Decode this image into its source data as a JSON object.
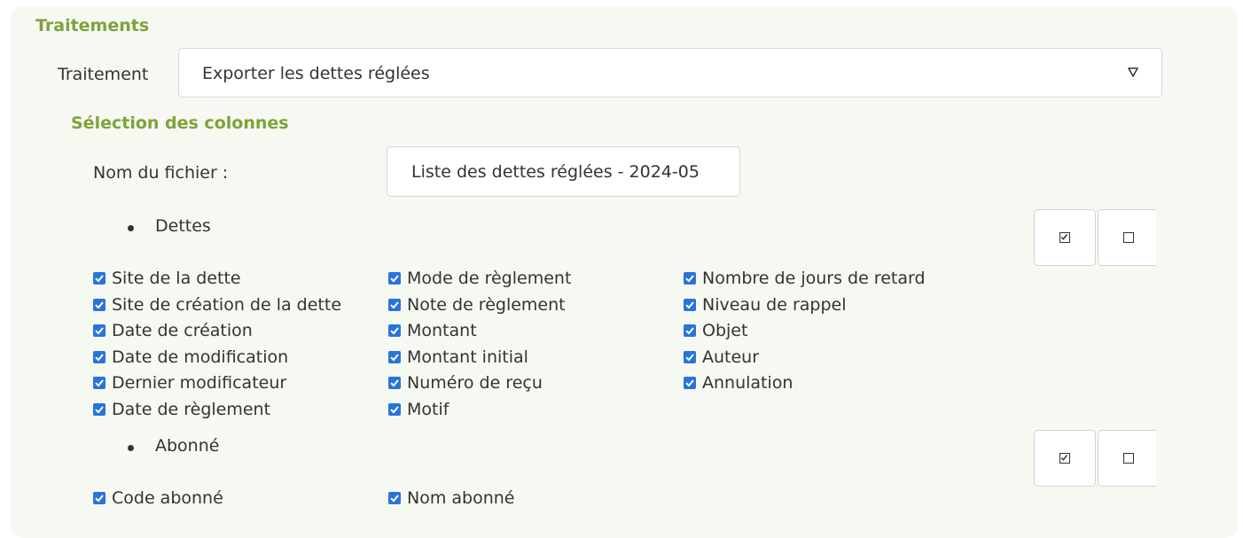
{
  "section": {
    "title": "Traitements"
  },
  "treatment": {
    "label": "Traitement",
    "selected": "Exporter les dettes réglées"
  },
  "columns": {
    "title": "Sélection des colonnes",
    "filename_label": "Nom du fichier :",
    "filename_value": "Liste des dettes réglées - 2024-05"
  },
  "groups": [
    {
      "name": "Dettes",
      "columns": [
        [
          "Site de la dette",
          "Site de création de la dette",
          "Date de création",
          "Date de modification",
          "Dernier modificateur",
          "Date de règlement"
        ],
        [
          "Mode de règlement",
          "Note de règlement",
          "Montant",
          "Montant initial",
          "Numéro de reçu",
          "Motif"
        ],
        [
          "Nombre de jours de retard",
          "Niveau de rappel",
          "Objet",
          "Auteur",
          "Annulation"
        ]
      ]
    },
    {
      "name": "Abonné",
      "columns": [
        [
          "Code abonné"
        ],
        [
          "Nom abonné"
        ]
      ]
    }
  ],
  "icons": {
    "caret": "caret-down-icon",
    "select_all": "checkbox-checked-icon",
    "deselect_all": "checkbox-empty-icon"
  },
  "colors": {
    "accent_green": "#7fa23a",
    "checkbox_blue": "#2a73d9",
    "panel_bg": "#f6f9f2"
  }
}
